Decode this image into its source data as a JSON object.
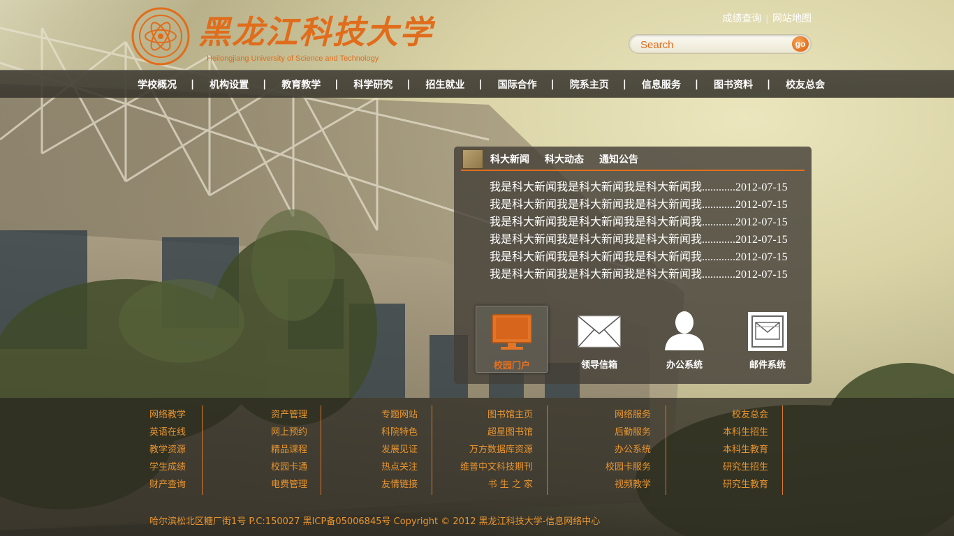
{
  "header": {
    "logo_text": "黑龙江科技大学",
    "logo_subtitle": "Heilongjiang University of Science and Technology",
    "top_links": [
      "成绩查询",
      "网站地图"
    ],
    "search_placeholder": "Search",
    "search_button": "go"
  },
  "nav": {
    "items": [
      {
        "label": "学校概况"
      },
      {
        "label": "机构设置"
      },
      {
        "label": "教育教学"
      },
      {
        "label": "科学研究"
      },
      {
        "label": "招生就业"
      },
      {
        "label": "国际合作"
      },
      {
        "label": "院系主页"
      },
      {
        "label": "信息服务"
      },
      {
        "label": "图书资料"
      },
      {
        "label": "校友总会"
      }
    ]
  },
  "news": {
    "tabs": [
      "科大新闻",
      "科大动态",
      "通知公告"
    ],
    "items": [
      "我是科大新闻我是科大新闻我是科大新闻我............2012-07-15",
      "我是科大新闻我是科大新闻我是科大新闻我............2012-07-15",
      "我是科大新闻我是科大新闻我是科大新闻我............2012-07-15",
      "我是科大新闻我是科大新闻我是科大新闻我............2012-07-15",
      "我是科大新闻我是科大新闻我是科大新闻我............2012-07-15",
      "我是科大新闻我是科大新闻我是科大新闻我............2012-07-15"
    ]
  },
  "quick_links": [
    {
      "label": "校园门户",
      "icon": "monitor-icon",
      "active": true
    },
    {
      "label": "领导信箱",
      "icon": "envelope-icon",
      "active": false
    },
    {
      "label": "办公系统",
      "icon": "person-icon",
      "active": false
    },
    {
      "label": "邮件系统",
      "icon": "mail-icon",
      "active": false
    }
  ],
  "footer": {
    "columns": [
      [
        "网络教学",
        "英语在线",
        "教学资源",
        "学生成绩",
        "财产查询"
      ],
      [
        "资产管理",
        "网上预约",
        "精品课程",
        "校园卡通",
        "电费管理"
      ],
      [
        "专题网站",
        "科院特色",
        "发展见证",
        "热点关注",
        "友情链接"
      ],
      [
        "图书馆主页",
        "超星图书馆",
        "万方数据库资源",
        "维普中文科技期刊",
        "书 生 之 家"
      ],
      [
        "网络服务",
        "后勤服务",
        "办公系统",
        "校园卡服务",
        "视频教学"
      ],
      [
        "校友总会",
        "本科生招生",
        "本科生教育",
        "研究生招生",
        "研究生教育"
      ]
    ],
    "copyright": "哈尔滨松北区糖厂街1号 P.C:150027  黑ICP备05006845号   Copyright © 2012  黑龙江科技大学-信息网络中心"
  },
  "colors": {
    "accent": "#e06d1c",
    "footer_link": "#e8952f",
    "nav_bg": "#46423a"
  }
}
